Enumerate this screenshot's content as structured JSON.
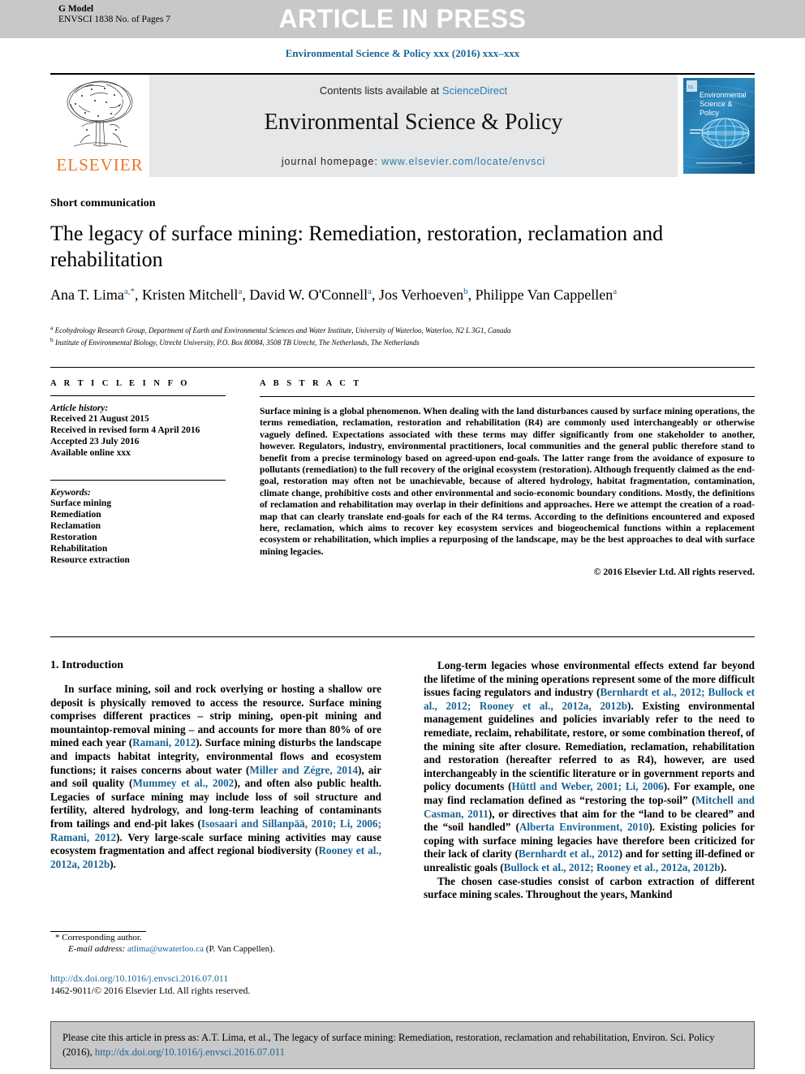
{
  "header": {
    "g_model": "G Model",
    "model_id": "ENVSCI 1838 No. of Pages 7",
    "press_banner": "ARTICLE IN PRESS",
    "running_head": "Environmental Science & Policy xxx (2016) xxx–xxx"
  },
  "masthead": {
    "publisher_logo_label": "ELSEVIER",
    "contents_prefix": "Contents lists available at",
    "contents_link": "ScienceDirect",
    "journal_name": "Environmental Science & Policy",
    "homepage_prefix": "journal homepage:",
    "homepage_link": "www.elsevier.com/locate/envsci",
    "cover_title_line1": "Environmental",
    "cover_title_line2": "Science &",
    "cover_title_line3": "Policy"
  },
  "article": {
    "type": "Short communication",
    "title": "The legacy of surface mining: Remediation, restoration, reclamation and rehabilitation",
    "authors_html": "Ana T. Lima<sup>a,*</sup>, Kristen Mitchell<sup>a</sup>, David W. O'Connell<sup>a</sup>, Jos Verhoeven<sup>b</sup>, Philippe Van Cappellen<sup>a</sup>",
    "affiliation_a": "Ecohydrology Research Group, Department of Earth and Environmental Sciences and Water Institute, University of Waterloo, Waterloo, N2 L 3G1, Canada",
    "affiliation_b": "Institute of Environmental Biology, Utrecht University, P.O. Box 80084, 3508 TB Utrecht, The Netherlands, The Netherlands"
  },
  "info": {
    "heading": "A R T I C L E  I N F O",
    "history_label": "Article history:",
    "history": [
      "Received 21 August 2015",
      "Received in revised form 4 April 2016",
      "Accepted 23 July 2016",
      "Available online xxx"
    ],
    "keywords_label": "Keywords:",
    "keywords": [
      "Surface mining",
      "Remediation",
      "Reclamation",
      "Restoration",
      "Rehabilitation",
      "Resource extraction"
    ]
  },
  "abstract": {
    "heading": "A B S T R A C T",
    "text": "Surface mining is a global phenomenon. When dealing with the land disturbances caused by surface mining operations, the terms remediation, reclamation, restoration and rehabilitation (R4) are commonly used interchangeably or otherwise vaguely defined. Expectations associated with these terms may differ significantly from one stakeholder to another, however. Regulators, industry, environmental practitioners, local communities and the general public therefore stand to benefit from a precise terminology based on agreed-upon end-goals. The latter range from the avoidance of exposure to pollutants (remediation) to the full recovery of the original ecosystem (restoration). Although frequently claimed as the end-goal, restoration may often not be unachievable, because of altered hydrology, habitat fragmentation, contamination, climate change, prohibitive costs and other environmental and socio-economic boundary conditions. Mostly, the definitions of reclamation and rehabilitation may overlap in their definitions and approaches. Here we attempt the creation of a road-map that can clearly translate end-goals for each of the R4 terms. According to the definitions encountered and exposed here, reclamation, which aims to recover key ecosystem services and biogeochemical functions within a replacement ecosystem or rehabilitation, which implies a repurposing of the landscape, may be the best approaches to deal with surface mining legacies.",
    "copyright": "© 2016 Elsevier Ltd. All rights reserved."
  },
  "body": {
    "section_heading": "1. Introduction",
    "left_paragraph_html": "In surface mining, soil and rock overlying or hosting a shallow ore deposit is physically removed to access the resource. Surface mining comprises different practices – strip mining, open-pit mining and mountaintop-removal mining – and accounts for more than 80% of ore mined each year (<span class=\"ref\">Ramani, 2012</span>). Surface mining disturbs the landscape and impacts habitat integrity, environmental flows and ecosystem functions; it raises concerns about water (<span class=\"ref\">Miller and Zégre, 2014</span>), air and soil quality (<span class=\"ref\">Mummey et al., 2002</span>), and often also public health. Legacies of surface mining may include loss of soil structure and fertility, altered hydrology, and long-term leaching of contaminants from tailings and end-pit lakes (<span class=\"ref\">Isosaari and Sillanpää, 2010; Li, 2006; Ramani, 2012</span>). Very large-scale surface mining activities may cause ecosystem fragmentation and affect regional biodiversity (<span class=\"ref\">Rooney et al., 2012a, 2012b</span>).",
    "right_paragraph_1_html": "Long-term legacies whose environmental effects extend far beyond the lifetime of the mining operations represent some of the more difficult issues facing regulators and industry (<span class=\"ref\">Bernhardt et al., 2012; Bullock et al., 2012; Rooney et al., 2012a, 2012b</span>). Existing environmental management guidelines and policies invariably refer to the need to remediate, reclaim, rehabilitate, restore, or some combination thereof, of the mining site after closure. Remediation, reclamation, rehabilitation and restoration (hereafter referred to as R4), however, are used interchangeably in the scientific literature or in government reports and policy documents (<span class=\"ref\">Hüttl and Weber, 2001; Li, 2006</span>). For example, one may find reclamation defined as “restoring the top-soil” (<span class=\"ref\">Mitchell and Casman, 2011</span>), or directives that aim for the “land to be cleared” and the “soil handled” (<span class=\"ref\">Alberta Environment, 2010</span>). Existing policies for coping with surface mining legacies have therefore been criticized for their lack of clarity (<span class=\"ref\">Bernhardt et al., 2012</span>) and for setting ill-defined or unrealistic goals (<span class=\"ref\">Bullock et al., 2012; Rooney et al., 2012a, 2012b</span>).",
    "right_paragraph_2_html": "The chosen case-studies consist of carbon extraction of different surface mining scales. Throughout the years, Mankind"
  },
  "footnote": {
    "corresponding_marker": "*",
    "corresponding_label": "Corresponding author.",
    "email_label": "E-mail address:",
    "email": "atlima@uwaterloo.ca",
    "email_owner": "(P. Van Cappellen)."
  },
  "doi": {
    "url": "http://dx.doi.org/10.1016/j.envsci.2016.07.011",
    "issn_line": "1462-9011/© 2016 Elsevier Ltd. All rights reserved."
  },
  "cite_box": {
    "text_before_link": "Please cite this article in press as: A.T. Lima, et al., The legacy of surface mining: Remediation, restoration, reclamation and rehabilitation, Environ. Sci. Policy (2016),",
    "link": "http://dx.doi.org/10.1016/j.envsci.2016.07.011"
  },
  "colors": {
    "link_blue": "#1a6496",
    "elsevier_orange": "#ee7623",
    "band_gray": "#c8c8c8",
    "masthead_gray": "#e6e7e8"
  }
}
